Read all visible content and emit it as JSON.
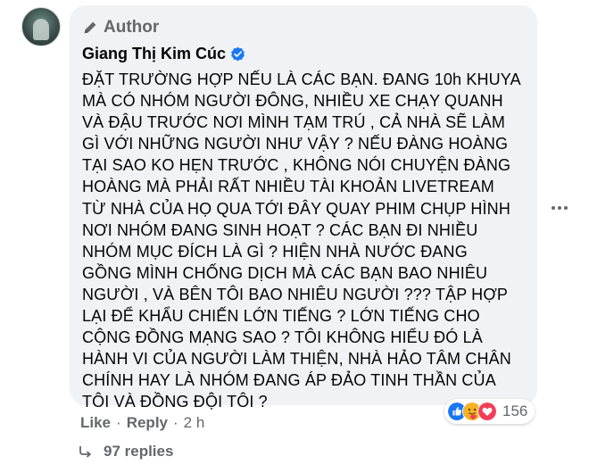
{
  "comment": {
    "author_badge": "Author",
    "name": "Giang Thị Kim Cúc",
    "lines": [
      "ĐẶT TRƯỜNG HỢP NẾU LÀ CÁC BẠN. ĐANG 10h KHUYA",
      "MÀ CÓ NHÓM NGƯỜI ĐÔNG, NHIỀU XE CHẠY QUANH",
      "VÀ ĐẬU TRƯỚC NƠI MÌNH TẠM TRÚ , CẢ NHÀ SẼ LÀM",
      "GÌ VỚI NHỮNG NGƯỜI NHƯ VẬY ? NẾU ĐÀNG HOÀNG",
      "TẠI SAO KO HẸN TRƯỚC , KHÔNG NÓI CHUYỆN ĐÀNG",
      "HOÀNG MÀ PHẢI RẤT NHIỀU TÀI KHOẢN LIVETREAM",
      "TỪ NHÀ CỦA HỌ QUA TỚI ĐÂY QUAY PHIM CHỤP HÌNH",
      "NƠI NHÓM ĐANG SINH HOẠT ? CÁC BẠN ĐI NHIỀU",
      "NHÓM MỤC ĐÍCH LÀ GÌ ? HIỆN NHÀ NƯỚC ĐANG",
      "GỒNG MÌNH CHỐNG DỊCH MÀ CÁC BẠN BAO NHIÊU",
      "NGƯỜI , VÀ BÊN TÔI BAO NHIÊU NGƯỜI ??? TẬP HỢP",
      "LẠI ĐỂ KHẨU CHIẾN LỚN TIẾNG ? LỚN TIẾNG CHO",
      "CỘNG ĐỒNG MẠNG SAO ? TÔI KHÔNG HIỂU ĐÓ LÀ",
      "HÀNH VI CỦA NGƯỜI LÀM THIỆN, NHÀ HẢO TÂM CHÂN",
      "CHÍNH HAY LÀ NHÓM ĐANG ÁP ĐẢO TINH THẦN CỦA",
      "TÔI VÀ ĐỒNG ĐỘI TÔI ?"
    ]
  },
  "actions": {
    "like": "Like",
    "separator": "·",
    "reply": "Reply",
    "time": "2 h"
  },
  "reactions": {
    "icons": [
      "like-icon",
      "care-icon",
      "love-icon"
    ],
    "count": "156"
  },
  "replies": {
    "label": "97 replies"
  },
  "colors": {
    "bubble": "#f0f2f5",
    "secondary_text": "#65676b",
    "verified": "#1877f2"
  }
}
